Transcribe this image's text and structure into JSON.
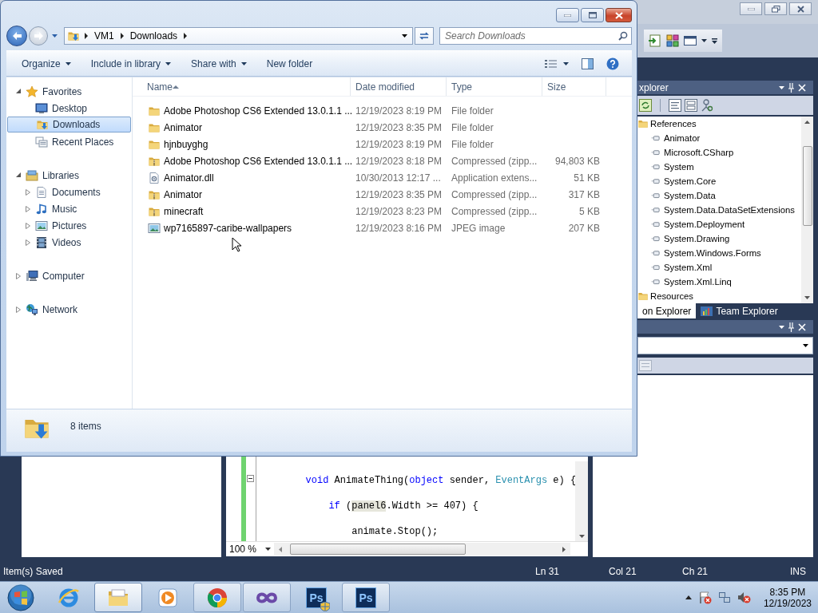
{
  "explorer": {
    "address": [
      {
        "label": "VM1"
      },
      {
        "label": "Downloads"
      }
    ],
    "search": {
      "placeholder": "Search Downloads"
    },
    "commands": [
      {
        "label": "Organize",
        "dropdown": true
      },
      {
        "label": "Include in library",
        "dropdown": true
      },
      {
        "label": "Share with",
        "dropdown": true
      },
      {
        "label": "New folder",
        "dropdown": false
      }
    ],
    "nav": [
      {
        "label": "Favorites",
        "kind": "favorites",
        "expanded": true,
        "children": [
          {
            "label": "Desktop",
            "kind": "desktop",
            "selected": false
          },
          {
            "label": "Downloads",
            "kind": "downloads",
            "selected": true
          },
          {
            "label": "Recent Places",
            "kind": "recent",
            "selected": false
          }
        ]
      },
      {
        "label": "Libraries",
        "kind": "libraries",
        "expanded": true,
        "children": [
          {
            "label": "Documents",
            "kind": "documents",
            "selected": false,
            "expanded": false
          },
          {
            "label": "Music",
            "kind": "music",
            "selected": false,
            "expanded": false
          },
          {
            "label": "Pictures",
            "kind": "pictures",
            "selected": false,
            "expanded": false
          },
          {
            "label": "Videos",
            "kind": "videos",
            "selected": false,
            "expanded": false
          }
        ]
      },
      {
        "label": "Computer",
        "kind": "computer",
        "expanded": false
      },
      {
        "label": "Network",
        "kind": "network",
        "expanded": false
      }
    ],
    "columns": [
      "Name",
      "Date modified",
      "Type",
      "Size"
    ],
    "files": [
      {
        "name": "Adobe Photoshop CS6 Extended 13.0.1.1 ...",
        "date": "12/19/2023 8:19 PM",
        "type": "File folder",
        "kind": "folder"
      },
      {
        "name": "Animator",
        "date": "12/19/2023 8:35 PM",
        "type": "File folder",
        "kind": "folder"
      },
      {
        "name": "hjnbuyghg",
        "date": "12/19/2023 8:19 PM",
        "type": "File folder",
        "kind": "folder"
      },
      {
        "name": "Adobe Photoshop CS6 Extended 13.0.1.1 ...",
        "date": "12/19/2023 8:18 PM",
        "type": "Compressed (zipp...",
        "size": "94,803 KB",
        "kind": "zip"
      },
      {
        "name": "Animator.dll",
        "date": "10/30/2013 12:17 ...",
        "type": "Application extens...",
        "size": "51 KB",
        "kind": "dll"
      },
      {
        "name": "Animator",
        "date": "12/19/2023 8:35 PM",
        "type": "Compressed (zipp...",
        "size": "317 KB",
        "kind": "zip"
      },
      {
        "name": "minecraft",
        "date": "12/19/2023 8:23 PM",
        "type": "Compressed (zipp...",
        "size": "5 KB",
        "kind": "zip"
      },
      {
        "name": "wp7165897-caribe-wallpapers",
        "date": "12/19/2023 8:16 PM",
        "type": "JPEG image",
        "size": "207 KB",
        "kind": "image"
      }
    ],
    "status": "8 items"
  },
  "ide": {
    "solution_explorer": {
      "title": "xplorer",
      "tree": [
        {
          "label": "References",
          "kind": "folder",
          "children": [
            {
              "label": "Animator",
              "kind": "reference"
            },
            {
              "label": "Microsoft.CSharp",
              "kind": "reference"
            },
            {
              "label": "System",
              "kind": "reference"
            },
            {
              "label": "System.Core",
              "kind": "reference"
            },
            {
              "label": "System.Data",
              "kind": "reference"
            },
            {
              "label": "System.Data.DataSetExtensions",
              "kind": "reference"
            },
            {
              "label": "System.Deployment",
              "kind": "reference"
            },
            {
              "label": "System.Drawing",
              "kind": "reference"
            },
            {
              "label": "System.Windows.Forms",
              "kind": "reference"
            },
            {
              "label": "System.Xml",
              "kind": "reference"
            },
            {
              "label": "System.Xml.Linq",
              "kind": "reference"
            }
          ]
        },
        {
          "label": "Resources",
          "kind": "folder"
        }
      ]
    },
    "tabs": [
      {
        "label": "on Explorer",
        "selected": true
      },
      {
        "label": "Team Explorer",
        "selected": false
      }
    ],
    "editor": {
      "zoom": "100 %",
      "lines": [
        {
          "collapsible": true,
          "tokens": [
            {
              "text": "        void",
              "kind": "keyword"
            },
            {
              "text": " AnimateThing(",
              "kind": "plain"
            },
            {
              "text": "object",
              "kind": "keyword"
            },
            {
              "text": " sender, ",
              "kind": "plain"
            },
            {
              "text": "EventArgs",
              "kind": "type"
            },
            {
              "text": " e) {",
              "kind": "plain"
            }
          ]
        },
        {
          "collapsible": false,
          "tokens": [
            {
              "text": "            if",
              "kind": "keyword"
            },
            {
              "text": " (",
              "kind": "plain"
            },
            {
              "text": "panel6",
              "kind": "reference_highlight"
            },
            {
              "text": ".Width >= 407) {",
              "kind": "plain"
            }
          ]
        },
        {
          "collapsible": false,
          "tokens": [
            {
              "text": "                animate.Stop();",
              "kind": "plain"
            }
          ]
        }
      ]
    },
    "status_bar": [
      "Item(s) Saved",
      "Ln 31",
      "Col 21",
      "Ch 21",
      "INS"
    ]
  },
  "taskbar": {
    "apps": [
      {
        "kind": "ie",
        "running": false,
        "active": false
      },
      {
        "kind": "explorer",
        "running": true,
        "active": true
      },
      {
        "kind": "media",
        "running": false,
        "active": false
      },
      {
        "kind": "chrome",
        "running": true,
        "active": false
      },
      {
        "kind": "vs",
        "running": true,
        "active": false
      },
      {
        "kind": "ps_admin",
        "running": false,
        "active": false,
        "label": "Ps"
      },
      {
        "kind": "ps",
        "running": true,
        "active": false,
        "label": "Ps"
      }
    ],
    "clock": {
      "time": "8:35 PM",
      "date": "12/19/2023"
    }
  }
}
